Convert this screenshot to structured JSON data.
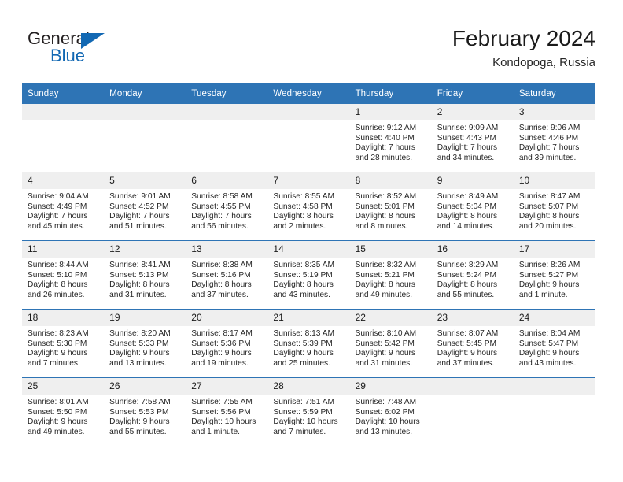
{
  "brand": {
    "name_part1": "General",
    "name_part2": "Blue",
    "triangle_color": "#1268b3",
    "text_color": "#231f20"
  },
  "header": {
    "title": "February 2024",
    "location": "Kondopoga, Russia",
    "accent_color": "#2e74b5",
    "daynum_band_color": "#efefef"
  },
  "weekday_headers": [
    "Sunday",
    "Monday",
    "Tuesday",
    "Wednesday",
    "Thursday",
    "Friday",
    "Saturday"
  ],
  "weeks": [
    [
      {
        "day": "",
        "lines": []
      },
      {
        "day": "",
        "lines": []
      },
      {
        "day": "",
        "lines": []
      },
      {
        "day": "",
        "lines": []
      },
      {
        "day": "1",
        "lines": [
          "Sunrise: 9:12 AM",
          "Sunset: 4:40 PM",
          "Daylight: 7 hours",
          "and 28 minutes."
        ]
      },
      {
        "day": "2",
        "lines": [
          "Sunrise: 9:09 AM",
          "Sunset: 4:43 PM",
          "Daylight: 7 hours",
          "and 34 minutes."
        ]
      },
      {
        "day": "3",
        "lines": [
          "Sunrise: 9:06 AM",
          "Sunset: 4:46 PM",
          "Daylight: 7 hours",
          "and 39 minutes."
        ]
      }
    ],
    [
      {
        "day": "4",
        "lines": [
          "Sunrise: 9:04 AM",
          "Sunset: 4:49 PM",
          "Daylight: 7 hours",
          "and 45 minutes."
        ]
      },
      {
        "day": "5",
        "lines": [
          "Sunrise: 9:01 AM",
          "Sunset: 4:52 PM",
          "Daylight: 7 hours",
          "and 51 minutes."
        ]
      },
      {
        "day": "6",
        "lines": [
          "Sunrise: 8:58 AM",
          "Sunset: 4:55 PM",
          "Daylight: 7 hours",
          "and 56 minutes."
        ]
      },
      {
        "day": "7",
        "lines": [
          "Sunrise: 8:55 AM",
          "Sunset: 4:58 PM",
          "Daylight: 8 hours",
          "and 2 minutes."
        ]
      },
      {
        "day": "8",
        "lines": [
          "Sunrise: 8:52 AM",
          "Sunset: 5:01 PM",
          "Daylight: 8 hours",
          "and 8 minutes."
        ]
      },
      {
        "day": "9",
        "lines": [
          "Sunrise: 8:49 AM",
          "Sunset: 5:04 PM",
          "Daylight: 8 hours",
          "and 14 minutes."
        ]
      },
      {
        "day": "10",
        "lines": [
          "Sunrise: 8:47 AM",
          "Sunset: 5:07 PM",
          "Daylight: 8 hours",
          "and 20 minutes."
        ]
      }
    ],
    [
      {
        "day": "11",
        "lines": [
          "Sunrise: 8:44 AM",
          "Sunset: 5:10 PM",
          "Daylight: 8 hours",
          "and 26 minutes."
        ]
      },
      {
        "day": "12",
        "lines": [
          "Sunrise: 8:41 AM",
          "Sunset: 5:13 PM",
          "Daylight: 8 hours",
          "and 31 minutes."
        ]
      },
      {
        "day": "13",
        "lines": [
          "Sunrise: 8:38 AM",
          "Sunset: 5:16 PM",
          "Daylight: 8 hours",
          "and 37 minutes."
        ]
      },
      {
        "day": "14",
        "lines": [
          "Sunrise: 8:35 AM",
          "Sunset: 5:19 PM",
          "Daylight: 8 hours",
          "and 43 minutes."
        ]
      },
      {
        "day": "15",
        "lines": [
          "Sunrise: 8:32 AM",
          "Sunset: 5:21 PM",
          "Daylight: 8 hours",
          "and 49 minutes."
        ]
      },
      {
        "day": "16",
        "lines": [
          "Sunrise: 8:29 AM",
          "Sunset: 5:24 PM",
          "Daylight: 8 hours",
          "and 55 minutes."
        ]
      },
      {
        "day": "17",
        "lines": [
          "Sunrise: 8:26 AM",
          "Sunset: 5:27 PM",
          "Daylight: 9 hours",
          "and 1 minute."
        ]
      }
    ],
    [
      {
        "day": "18",
        "lines": [
          "Sunrise: 8:23 AM",
          "Sunset: 5:30 PM",
          "Daylight: 9 hours",
          "and 7 minutes."
        ]
      },
      {
        "day": "19",
        "lines": [
          "Sunrise: 8:20 AM",
          "Sunset: 5:33 PM",
          "Daylight: 9 hours",
          "and 13 minutes."
        ]
      },
      {
        "day": "20",
        "lines": [
          "Sunrise: 8:17 AM",
          "Sunset: 5:36 PM",
          "Daylight: 9 hours",
          "and 19 minutes."
        ]
      },
      {
        "day": "21",
        "lines": [
          "Sunrise: 8:13 AM",
          "Sunset: 5:39 PM",
          "Daylight: 9 hours",
          "and 25 minutes."
        ]
      },
      {
        "day": "22",
        "lines": [
          "Sunrise: 8:10 AM",
          "Sunset: 5:42 PM",
          "Daylight: 9 hours",
          "and 31 minutes."
        ]
      },
      {
        "day": "23",
        "lines": [
          "Sunrise: 8:07 AM",
          "Sunset: 5:45 PM",
          "Daylight: 9 hours",
          "and 37 minutes."
        ]
      },
      {
        "day": "24",
        "lines": [
          "Sunrise: 8:04 AM",
          "Sunset: 5:47 PM",
          "Daylight: 9 hours",
          "and 43 minutes."
        ]
      }
    ],
    [
      {
        "day": "25",
        "lines": [
          "Sunrise: 8:01 AM",
          "Sunset: 5:50 PM",
          "Daylight: 9 hours",
          "and 49 minutes."
        ]
      },
      {
        "day": "26",
        "lines": [
          "Sunrise: 7:58 AM",
          "Sunset: 5:53 PM",
          "Daylight: 9 hours",
          "and 55 minutes."
        ]
      },
      {
        "day": "27",
        "lines": [
          "Sunrise: 7:55 AM",
          "Sunset: 5:56 PM",
          "Daylight: 10 hours",
          "and 1 minute."
        ]
      },
      {
        "day": "28",
        "lines": [
          "Sunrise: 7:51 AM",
          "Sunset: 5:59 PM",
          "Daylight: 10 hours",
          "and 7 minutes."
        ]
      },
      {
        "day": "29",
        "lines": [
          "Sunrise: 7:48 AM",
          "Sunset: 6:02 PM",
          "Daylight: 10 hours",
          "and 13 minutes."
        ]
      },
      {
        "day": "",
        "lines": []
      },
      {
        "day": "",
        "lines": []
      }
    ]
  ]
}
